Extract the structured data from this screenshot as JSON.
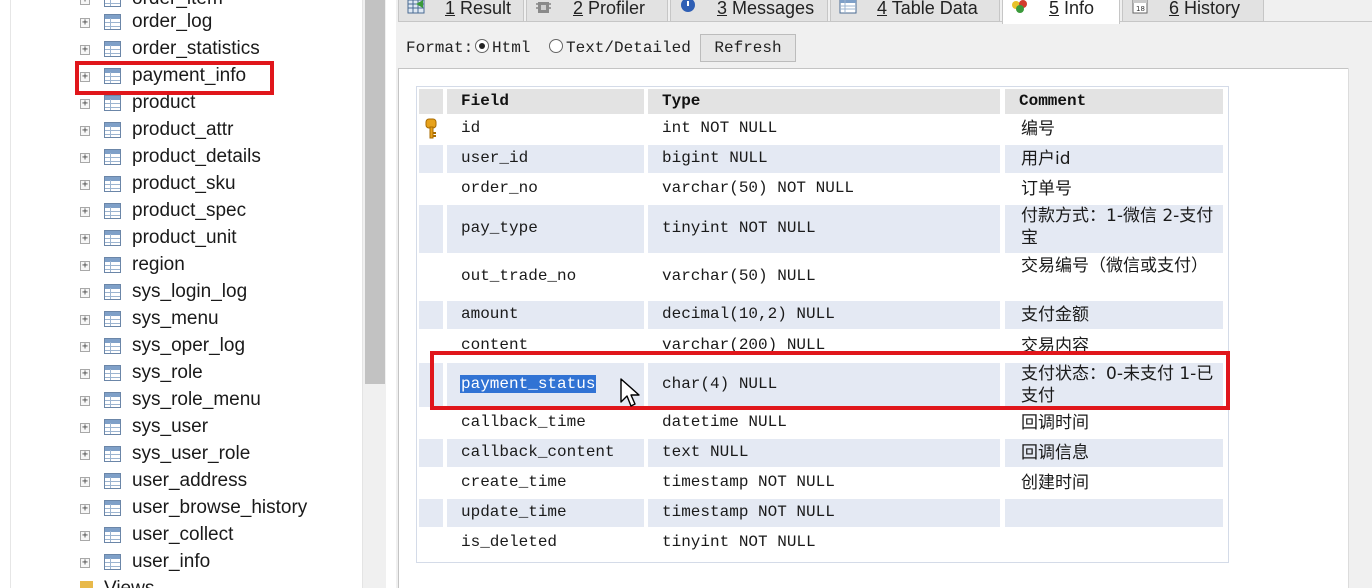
{
  "tree": {
    "partial_top_label": "order_item",
    "items": [
      {
        "label": "order_log",
        "highlighted": false
      },
      {
        "label": "order_statistics",
        "highlighted": false
      },
      {
        "label": "payment_info",
        "highlighted": true
      },
      {
        "label": "product",
        "highlighted": false
      },
      {
        "label": "product_attr",
        "highlighted": false
      },
      {
        "label": "product_details",
        "highlighted": false
      },
      {
        "label": "product_sku",
        "highlighted": false
      },
      {
        "label": "product_spec",
        "highlighted": false
      },
      {
        "label": "product_unit",
        "highlighted": false
      },
      {
        "label": "region",
        "highlighted": false
      },
      {
        "label": "sys_login_log",
        "highlighted": false
      },
      {
        "label": "sys_menu",
        "highlighted": false
      },
      {
        "label": "sys_oper_log",
        "highlighted": false
      },
      {
        "label": "sys_role",
        "highlighted": false
      },
      {
        "label": "sys_role_menu",
        "highlighted": false
      },
      {
        "label": "sys_user",
        "highlighted": false
      },
      {
        "label": "sys_user_role",
        "highlighted": false
      },
      {
        "label": "user_address",
        "highlighted": false
      },
      {
        "label": "user_browse_history",
        "highlighted": false
      },
      {
        "label": "user_collect",
        "highlighted": false
      },
      {
        "label": "user_info",
        "highlighted": false
      }
    ],
    "partial_bottom_label": "Views",
    "expander_glyph": "+"
  },
  "tabs": [
    {
      "number": "1",
      "label": "Result",
      "icon": "result-grid-icon",
      "active": false
    },
    {
      "number": "2",
      "label": "Profiler",
      "icon": "profiler-icon",
      "active": false
    },
    {
      "number": "3",
      "label": "Messages",
      "icon": "messages-icon",
      "active": false
    },
    {
      "number": "4",
      "label": "Table Data",
      "icon": "table-data-icon",
      "active": false
    },
    {
      "number": "5",
      "label": "Info",
      "icon": "info-icon",
      "active": true
    },
    {
      "number": "6",
      "label": "History",
      "icon": "history-calendar-icon",
      "active": false
    }
  ],
  "toolbar": {
    "format_label": "Format:",
    "options": [
      {
        "label": "Html",
        "selected": true
      },
      {
        "label": "Text/Detailed",
        "selected": false
      }
    ],
    "refresh_label": "Refresh"
  },
  "field_table": {
    "headers": {
      "field": "Field",
      "type": "Type",
      "comment": "Comment"
    },
    "rows": [
      {
        "field": "id",
        "type": "int NOT NULL",
        "comment": "编号",
        "primary_key": true,
        "selected": false
      },
      {
        "field": "user_id",
        "type": "bigint NULL",
        "comment": "用户id",
        "primary_key": false,
        "selected": false
      },
      {
        "field": "order_no",
        "type": "varchar(50) NOT NULL",
        "comment": "订单号",
        "primary_key": false,
        "selected": false
      },
      {
        "field": "pay_type",
        "type": "tinyint NOT NULL",
        "comment": "付款方式：1-微信 2-支付宝",
        "primary_key": false,
        "selected": false
      },
      {
        "field": "out_trade_no",
        "type": "varchar(50) NULL",
        "comment": "交易编号（微信或支付）",
        "primary_key": false,
        "selected": false
      },
      {
        "field": "amount",
        "type": "decimal(10,2) NULL",
        "comment": "支付金额",
        "primary_key": false,
        "selected": false
      },
      {
        "field": "content",
        "type": "varchar(200) NULL",
        "comment": "交易内容",
        "primary_key": false,
        "selected": false
      },
      {
        "field": "payment_status",
        "type": "char(4) NULL",
        "comment": "支付状态：0-未支付 1-已支付",
        "primary_key": false,
        "selected": true
      },
      {
        "field": "callback_time",
        "type": "datetime NULL",
        "comment": "回调时间",
        "primary_key": false,
        "selected": false
      },
      {
        "field": "callback_content",
        "type": "text NULL",
        "comment": "回调信息",
        "primary_key": false,
        "selected": false
      },
      {
        "field": "create_time",
        "type": "timestamp NOT NULL",
        "comment": "创建时间",
        "primary_key": false,
        "selected": false
      },
      {
        "field": "update_time",
        "type": "timestamp NOT NULL",
        "comment": "",
        "primary_key": false,
        "selected": false
      },
      {
        "field": "is_deleted",
        "type": "tinyint NOT NULL",
        "comment": "",
        "primary_key": false,
        "selected": false
      }
    ]
  },
  "colors": {
    "annotation_red": "#e0161b",
    "row_shade": "#e4e9f3",
    "selection_blue": "#3173d4",
    "header_gray": "#e3e3e3"
  }
}
